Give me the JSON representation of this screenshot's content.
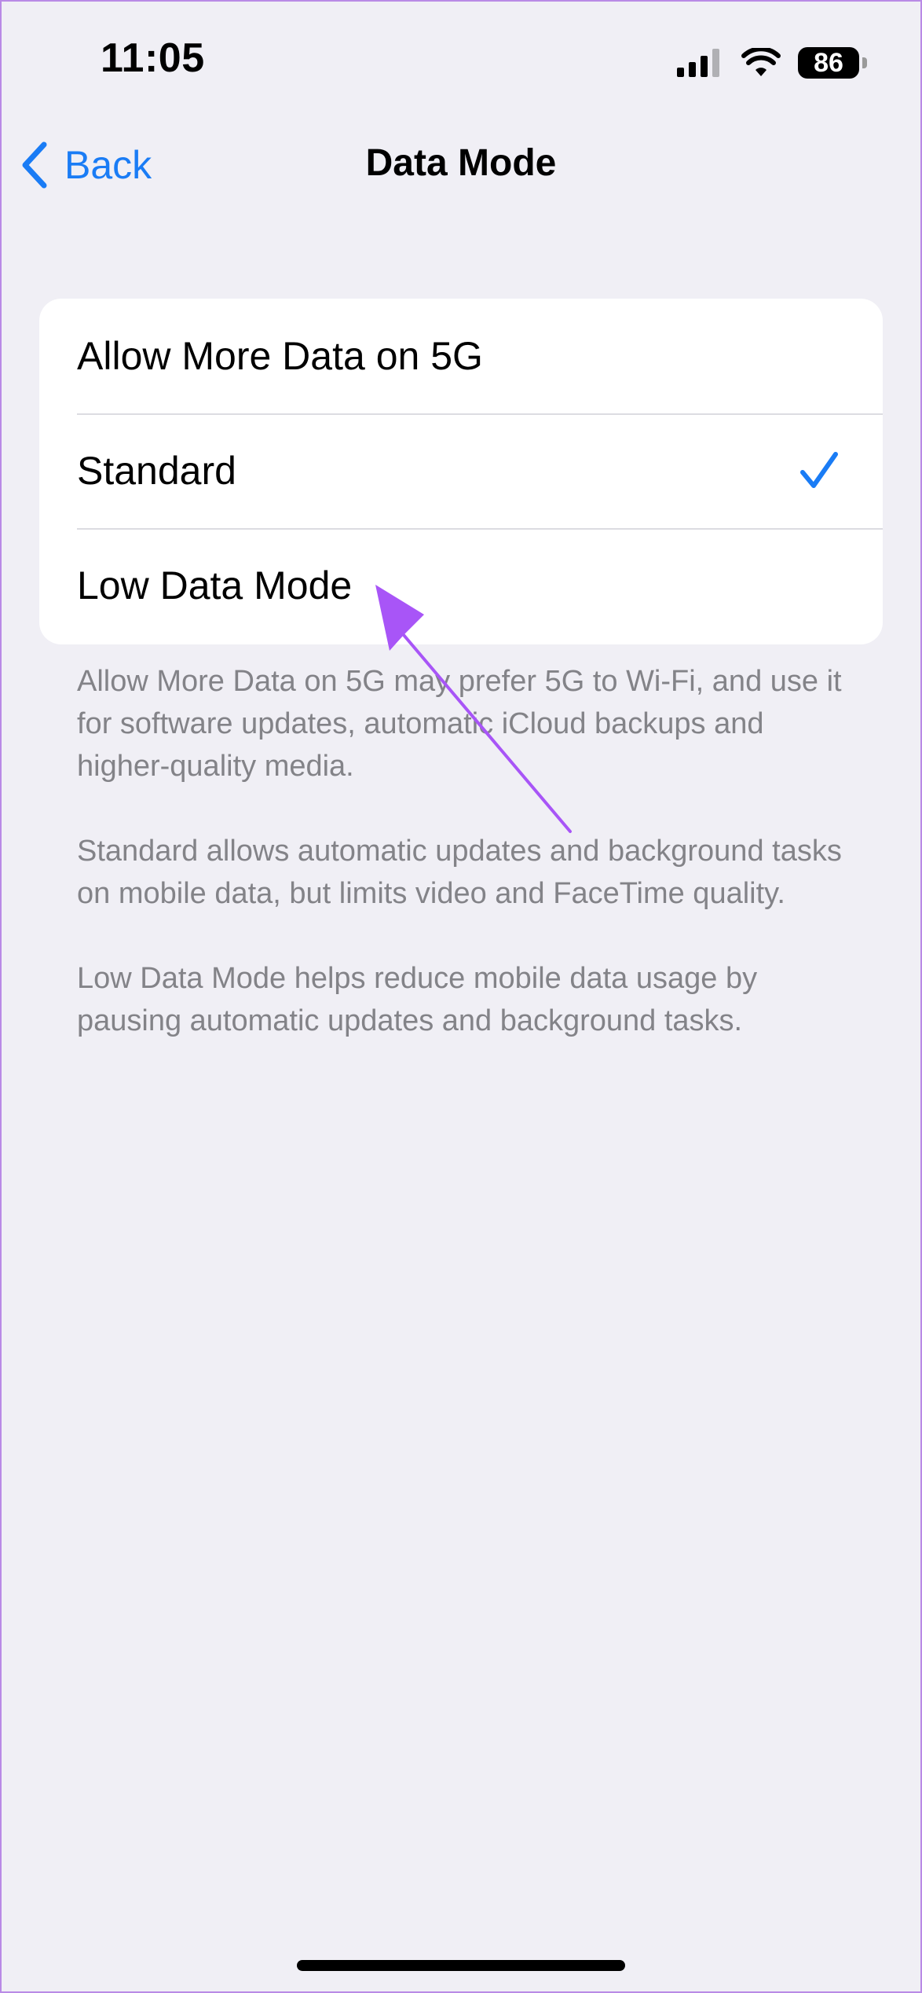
{
  "status_bar": {
    "time": "11:05",
    "battery_level": "86",
    "icons": [
      "signal-icon",
      "wifi-icon",
      "battery-icon"
    ]
  },
  "nav": {
    "back_label": "Back",
    "title": "Data Mode"
  },
  "options": [
    {
      "label": "Allow More Data on 5G",
      "selected": false
    },
    {
      "label": "Standard",
      "selected": true
    },
    {
      "label": "Low Data Mode",
      "selected": false
    }
  ],
  "descriptions": [
    "Allow More Data on 5G may prefer 5G to Wi-Fi, and use it for software updates, automatic iCloud backups and higher-quality media.",
    "Standard allows automatic updates and background tasks on mobile data, but limits video and FaceTime quality.",
    "Low Data Mode helps reduce mobile data usage by pausing automatic updates and background tasks."
  ],
  "colors": {
    "accent": "#1a7cf5",
    "background": "#f0eff5",
    "annotation_arrow": "#a855f7",
    "footnote_text": "#838388"
  }
}
